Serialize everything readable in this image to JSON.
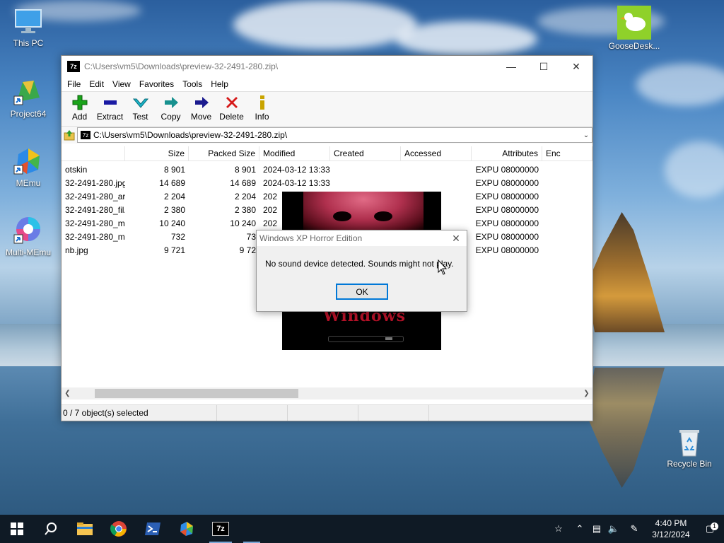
{
  "desktop": {
    "icons": [
      {
        "label": "This PC"
      },
      {
        "label": "Project64"
      },
      {
        "label": "MEmu"
      },
      {
        "label": "Multi-MEmu"
      },
      {
        "label": "GooseDesk..."
      },
      {
        "label": "Recycle Bin"
      }
    ]
  },
  "window": {
    "title": "C:\\Users\\vm5\\Downloads\\preview-32-2491-280.zip\\",
    "app_icon_text": "7z",
    "menu": [
      "File",
      "Edit",
      "View",
      "Favorites",
      "Tools",
      "Help"
    ],
    "toolbar": [
      {
        "label": "Add",
        "icon": "plus-icon",
        "color": "#1aa31a"
      },
      {
        "label": "Extract",
        "icon": "minus-icon",
        "color": "#1a1aa3"
      },
      {
        "label": "Test",
        "icon": "check-icon",
        "color": "#1ab5c9"
      },
      {
        "label": "Copy",
        "icon": "copy-arrow-icon",
        "color": "#17918f"
      },
      {
        "label": "Move",
        "icon": "move-arrow-icon",
        "color": "#1b1b8f"
      },
      {
        "label": "Delete",
        "icon": "x-icon",
        "color": "#d61a1a"
      },
      {
        "label": "Info",
        "icon": "info-icon",
        "color": "#c9a400"
      }
    ],
    "address": "C:\\Users\\vm5\\Downloads\\preview-32-2491-280.zip\\",
    "columns": [
      "",
      "Size",
      "Packed Size",
      "Modified",
      "Created",
      "Accessed",
      "Attributes",
      "Enc"
    ],
    "rows": [
      {
        "name": "otskin",
        "size": "8 901",
        "packed": "8 901",
        "modified": "2024-03-12 13:33",
        "created": "",
        "accessed": "",
        "attributes": "EXPU 08000000"
      },
      {
        "name": "32-2491-280.jpg",
        "size": "14 689",
        "packed": "14 689",
        "modified": "2024-03-12 13:33",
        "created": "",
        "accessed": "",
        "attributes": "EXPU 08000000"
      },
      {
        "name": "32-2491-280_ar...",
        "size": "2 204",
        "packed": "2 204",
        "modified": "202",
        "created": "",
        "accessed": "",
        "attributes": "EXPU 08000000"
      },
      {
        "name": "32-2491-280_fil...",
        "size": "2 380",
        "packed": "2 380",
        "modified": "202",
        "created": "",
        "accessed": "",
        "attributes": "EXPU 08000000"
      },
      {
        "name": "32-2491-280_m...",
        "size": "10 240",
        "packed": "10 240",
        "modified": "202",
        "created": "",
        "accessed": "",
        "attributes": "EXPU 08000000"
      },
      {
        "name": "32-2491-280_m...",
        "size": "732",
        "packed": "73",
        "modified": "",
        "created": "",
        "accessed": "",
        "attributes": "EXPU 08000000"
      },
      {
        "name": "nb.jpg",
        "size": "9 721",
        "packed": "9 72",
        "modified": "",
        "created": "",
        "accessed": "",
        "attributes": "EXPU 08000000"
      }
    ],
    "status": "0 / 7 object(s) selected"
  },
  "preview_image": {
    "logo_text": "Windows"
  },
  "dialog": {
    "title": "Windows XP Horror Edition",
    "message": "No sound device detected. Sounds might not play.",
    "ok_label": "OK"
  },
  "taskbar": {
    "time": "4:40 PM",
    "date": "3/12/2024",
    "notification_count": "1"
  }
}
